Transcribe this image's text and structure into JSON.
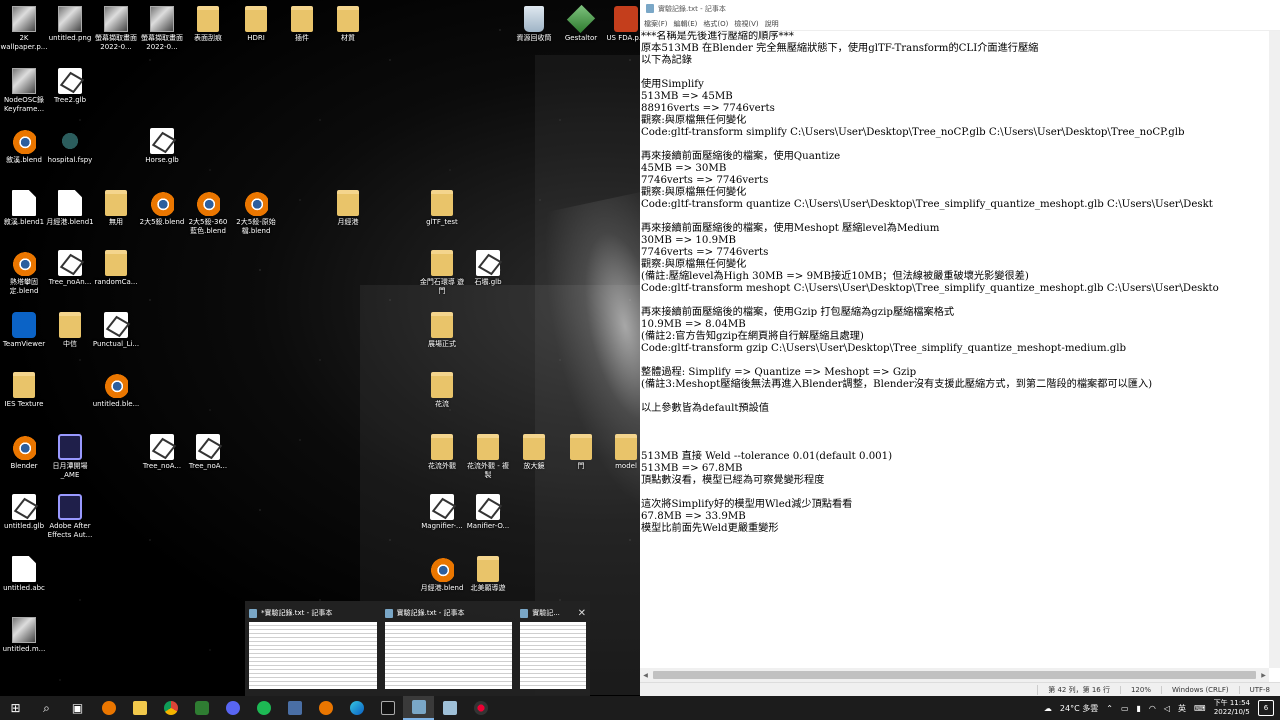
{
  "desktop": {
    "icons": [
      {
        "label": "2K wallpaper.p...",
        "icon": "image-icon"
      },
      {
        "label": "untitled.png",
        "icon": "image-icon"
      },
      {
        "label": "螢幕擷取畫面 2022-0...",
        "icon": "image-icon"
      },
      {
        "label": "螢幕擷取畫面 2022-0...",
        "icon": "image-icon"
      },
      {
        "label": "表面刮痕",
        "icon": "folder-icon"
      },
      {
        "label": "HDRI",
        "icon": "folder-icon"
      },
      {
        "label": "插件",
        "icon": "folder-icon"
      },
      {
        "label": "材質",
        "icon": "folder-icon"
      },
      {
        "label": "資源回收筒",
        "icon": "recycle-bin-icon"
      },
      {
        "label": "Gestaltor",
        "icon": "gestaltor-icon"
      },
      {
        "label": "US FDA.p...",
        "icon": "powerpoint-icon"
      },
      {
        "label": "NodeOSC錄 Keyframe...",
        "icon": "image-icon"
      },
      {
        "label": "Tree2.glb",
        "icon": "glb-file-icon"
      },
      {
        "label": "敘溪.blend",
        "icon": "blender-icon"
      },
      {
        "label": "hospital.fspy",
        "icon": "fspy-icon"
      },
      {
        "label": "Horse.glb",
        "icon": "glb-file-icon"
      },
      {
        "label": "敘溪.blend1",
        "icon": "file-icon"
      },
      {
        "label": "月經港.blend1",
        "icon": "file-icon"
      },
      {
        "label": "無用",
        "icon": "folder-icon"
      },
      {
        "label": "2大5殺.blend",
        "icon": "blender-icon"
      },
      {
        "label": "2大5殺-360 藍色.blend",
        "icon": "blender-icon"
      },
      {
        "label": "2大5殺-原始 檔.blend",
        "icon": "blender-icon"
      },
      {
        "label": "月經港",
        "icon": "folder-icon"
      },
      {
        "label": "glTF_test",
        "icon": "folder-icon"
      },
      {
        "label": "熱塔攀固定.blend",
        "icon": "blender-icon"
      },
      {
        "label": "Tree_noAn...",
        "icon": "glb-file-icon"
      },
      {
        "label": "randomCa...",
        "icon": "folder-icon"
      },
      {
        "label": "金門石環導 遊門",
        "icon": "folder-icon"
      },
      {
        "label": "石壩.glb",
        "icon": "glb-file-icon"
      },
      {
        "label": "TeamViewer",
        "icon": "teamviewer-icon"
      },
      {
        "label": "中信",
        "icon": "folder-icon"
      },
      {
        "label": "Punctual_Li...",
        "icon": "glb-file-icon"
      },
      {
        "label": "展場正式",
        "icon": "folder-icon"
      },
      {
        "label": "IES Texture",
        "icon": "folder-icon"
      },
      {
        "label": "untitled.ble...",
        "icon": "blender-icon"
      },
      {
        "label": "花流",
        "icon": "folder-icon"
      },
      {
        "label": "Blender",
        "icon": "blender-icon"
      },
      {
        "label": "日月潭開場 _AME",
        "icon": "after-effects-icon"
      },
      {
        "label": "Tree_noA...",
        "icon": "glb-file-icon"
      },
      {
        "label": "Tree_noA...",
        "icon": "glb-file-icon"
      },
      {
        "label": "花流外觀",
        "icon": "folder-icon"
      },
      {
        "label": "花流外觀 - 複製",
        "icon": "folder-icon"
      },
      {
        "label": "放大鏡",
        "icon": "folder-icon"
      },
      {
        "label": "門",
        "icon": "folder-icon"
      },
      {
        "label": "model",
        "icon": "folder-icon"
      },
      {
        "label": "untitled.glb",
        "icon": "glb-file-icon"
      },
      {
        "label": "Adobe After Effects Aut...",
        "icon": "after-effects-icon"
      },
      {
        "label": "Magnifier-...",
        "icon": "glb-file-icon"
      },
      {
        "label": "Manifier-O...",
        "icon": "glb-file-icon"
      },
      {
        "label": "untitled.abc",
        "icon": "file-icon"
      },
      {
        "label": "月經港.blend",
        "icon": "blender-icon"
      },
      {
        "label": "北美願導遊",
        "icon": "folder-icon"
      },
      {
        "label": "untitled.m...",
        "icon": "image-icon"
      }
    ]
  },
  "notepad": {
    "title": "實驗記錄.txt - 記事本",
    "menu": [
      "檔案(F)",
      "編輯(E)",
      "格式(O)",
      "檢視(V)",
      "說明"
    ],
    "lines": [
      "***名稱是先後進行壓縮的順序***",
      "原本513MB 在Blender 完全無壓縮狀態下，使用glTF-Transform的CLI介面進行壓縮",
      "以下為記錄",
      "",
      "使用Simplify",
      "513MB => 45MB",
      "88916verts => 7746verts",
      "觀察:與原檔無任何變化",
      "Code:gltf-transform simplify C:\\Users\\User\\Desktop\\Tree_noCP.glb C:\\Users\\User\\Desktop\\Tree_noCP.glb",
      "",
      "再來接續前面壓縮後的檔案，使用Quantize",
      "45MB => 30MB",
      "7746verts => 7746verts",
      "觀察:與原檔無任何變化",
      "Code:gltf-transform quantize C:\\Users\\User\\Desktop\\Tree_simplify_quantize_meshopt.glb C:\\Users\\User\\Deskt",
      "",
      "再來接續前面壓縮後的檔案，使用Meshopt 壓縮level為Medium",
      "30MB => 10.9MB",
      "7746verts => 7746verts",
      "觀察:與原檔無任何變化",
      "(備註:壓縮level為High 30MB => 9MB接近10MB；但法線被嚴重破壞光影變很差)",
      "Code:gltf-transform meshopt C:\\Users\\User\\Desktop\\Tree_simplify_quantize_meshopt.glb C:\\Users\\User\\Deskto",
      "",
      "再來接續前面壓縮後的檔案，使用Gzip 打包壓縮為gzip壓縮檔案格式",
      "10.9MB => 8.04MB",
      "(備註2:官方告知gzip在網頁將自行解壓縮且處理)",
      "Code:gltf-transform gzip C:\\Users\\User\\Desktop\\Tree_simplify_quantize_meshopt-medium.glb",
      "",
      "整體過程: Simplify => Quantize => Meshopt => Gzip",
      "(備註3:Meshopt壓縮後無法再進入Blender調整，Blender沒有支援此壓縮方式，到第二階段的檔案都可以匯入)",
      "",
      "以上參數皆為default預設值",
      "",
      "",
      "",
      "513MB 直接 Weld --tolerance 0.01(default 0.001)",
      "513MB => 67.8MB",
      "頂點數沒看，模型已經為可察覺變形程度",
      "",
      "這次將Simplify好的模型用Wled減少頂點看看",
      "67.8MB => 33.9MB",
      "模型比前面先Weld更嚴重變形"
    ],
    "status": {
      "position": "第 42 列，第 16 行",
      "zoom": "120%",
      "line_ending": "Windows (CRLF)",
      "encoding": "UTF-8"
    }
  },
  "thumbnails": [
    {
      "title": "*實驗記錄.txt - 記事本"
    },
    {
      "title": "實驗記錄.txt - 記事本"
    },
    {
      "title": "實驗記..."
    }
  ],
  "taskbar": {
    "apps": [
      "windows-start-icon",
      "search-icon",
      "task-view-icon",
      "blender-icon",
      "file-explorer-icon",
      "chrome-icon",
      "xbox-icon",
      "discord-icon",
      "spotify-icon",
      "calculator-icon",
      "blender-icon",
      "edge-icon",
      "terminal-icon",
      "notepad-icon",
      "notepad-icon",
      "davinci-icon"
    ],
    "weather": "24°C 多雲",
    "ime": "英",
    "time": "下午 11:54",
    "date": "2022/10/5",
    "notifications": "6"
  }
}
